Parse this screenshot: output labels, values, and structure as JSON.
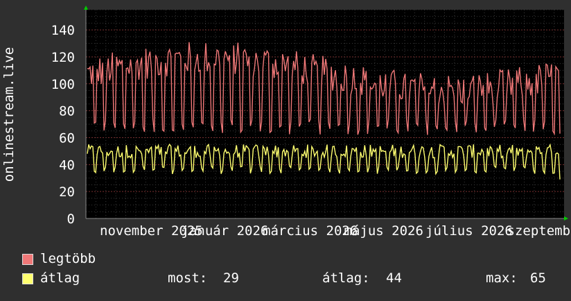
{
  "chart_data": {
    "type": "line",
    "ylabel": "onlinestream.live",
    "ylim": [
      0,
      155
    ],
    "yticks": [
      0,
      20,
      40,
      60,
      80,
      100,
      120,
      140
    ],
    "grid": true,
    "x_tick_labels": [
      "november 2025",
      "január 2026",
      "március 2026",
      "május 2026",
      "július 2026",
      "szeptember"
    ],
    "series": [
      {
        "name": "legtöbb",
        "color": "#f07878"
      },
      {
        "name": "átlag",
        "color": "#ffff70"
      }
    ],
    "legend_position": "bottom-left",
    "stats": {
      "most_label": "most:",
      "most_value": "29",
      "atlag_label": "átlag:",
      "atlag_value": "44",
      "max_label": "max:",
      "max_value": "65"
    }
  }
}
